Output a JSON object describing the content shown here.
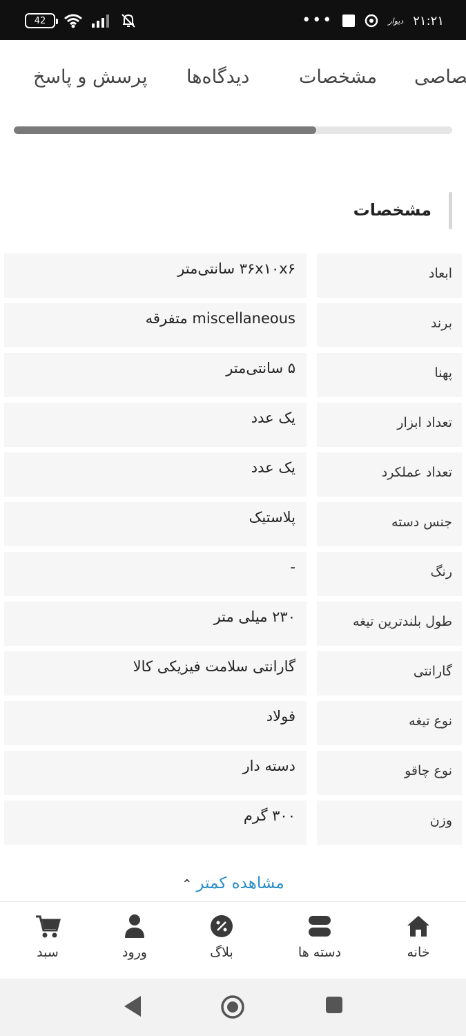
{
  "status_bar": {
    "battery": "42",
    "time": "۲۱:۲۱",
    "app_label": "دیوار",
    "more": "•••"
  },
  "tabs": [
    {
      "label": "پرسش و پاسخ"
    },
    {
      "label": "دیدگاه‌ها"
    },
    {
      "label": "مشخصات"
    },
    {
      "label": "مشخصات اختصاصی"
    }
  ],
  "tab_scroll_progress": 0.69,
  "section": {
    "title": "مشخصات"
  },
  "specs": [
    {
      "key": "ابعاد",
      "value": "۳۶x۱۰x۶ سانتی‌متر"
    },
    {
      "key": "برند",
      "value": "miscellaneous متفرقه"
    },
    {
      "key": "پهنا",
      "value": "۵ سانتی‌متر"
    },
    {
      "key": "تعداد ابزار",
      "value": "یک عدد"
    },
    {
      "key": "تعداد عملکرد",
      "value": "یک عدد"
    },
    {
      "key": "جنس دسته",
      "value": "پلاستیک"
    },
    {
      "key": "رنگ",
      "value": "-"
    },
    {
      "key": "طول بلندترین تیغه",
      "value": "۲۳۰ میلی متر"
    },
    {
      "key": "گارانتی",
      "value": "گارانتی سلامت فیزیکی کالا"
    },
    {
      "key": "نوع تیغه",
      "value": "فولاد"
    },
    {
      "key": "نوع چاقو",
      "value": "دسته دار"
    },
    {
      "key": "وزن",
      "value": "۳۰۰ گرم"
    }
  ],
  "show_less": {
    "label": "مشاهده کمتر"
  },
  "bottom_nav": [
    {
      "label": "خانه",
      "icon": "home-icon"
    },
    {
      "label": "دسته ها",
      "icon": "categories-icon"
    },
    {
      "label": "بلاگ",
      "icon": "blog-percent-icon"
    },
    {
      "label": "ورود",
      "icon": "user-icon"
    },
    {
      "label": "سبد",
      "icon": "cart-icon"
    }
  ],
  "colors": {
    "accent": "#2a8ec9",
    "status_bar": "#101010",
    "cell_bg": "#f6f6f6",
    "progress_fill": "#7a7a7a"
  }
}
